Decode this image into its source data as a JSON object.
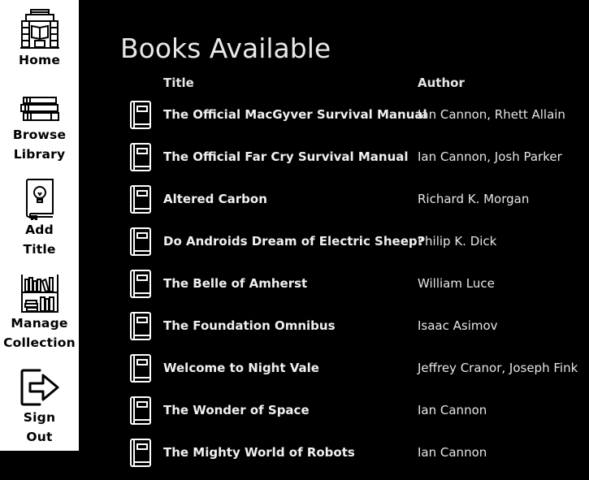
{
  "sidebar": {
    "items": [
      {
        "label_line1": "Home",
        "label_line2": "",
        "icon": "library-building-icon"
      },
      {
        "label_line1": "Browse",
        "label_line2": "Library",
        "icon": "book-stack-icon"
      },
      {
        "label_line1": "Add",
        "label_line2": "Title",
        "icon": "book-lightbulb-icon"
      },
      {
        "label_line1": "Manage",
        "label_line2": "Collection",
        "icon": "bookshelf-icon"
      },
      {
        "label_line1": "Sign",
        "label_line2": "Out",
        "icon": "sign-out-arrow-icon"
      }
    ]
  },
  "main": {
    "title": "Books Available",
    "columns": {
      "title": "Title",
      "author": "Author"
    },
    "books": [
      {
        "title": "The Official MacGyver Survival Manual",
        "author": "Ian Cannon, Rhett Allain"
      },
      {
        "title": "The Official Far Cry Survival Manual",
        "author": "Ian Cannon, Josh Parker"
      },
      {
        "title": "Altered Carbon",
        "author": "Richard K. Morgan"
      },
      {
        "title": "Do Androids Dream of Electric Sheep?",
        "author": "Philip K. Dick"
      },
      {
        "title": "The Belle of Amherst",
        "author": "William Luce"
      },
      {
        "title": "The Foundation Omnibus",
        "author": "Isaac Asimov"
      },
      {
        "title": "Welcome to Night Vale",
        "author": "Jeffrey Cranor, Joseph Fink"
      },
      {
        "title": "The Wonder of Space",
        "author": "Ian Cannon"
      },
      {
        "title": "The Mighty World of Robots",
        "author": "Ian Cannon"
      }
    ]
  },
  "colors": {
    "sidebar_bg": "#ffffff",
    "main_bg": "#000000",
    "text": "#ffffff"
  }
}
